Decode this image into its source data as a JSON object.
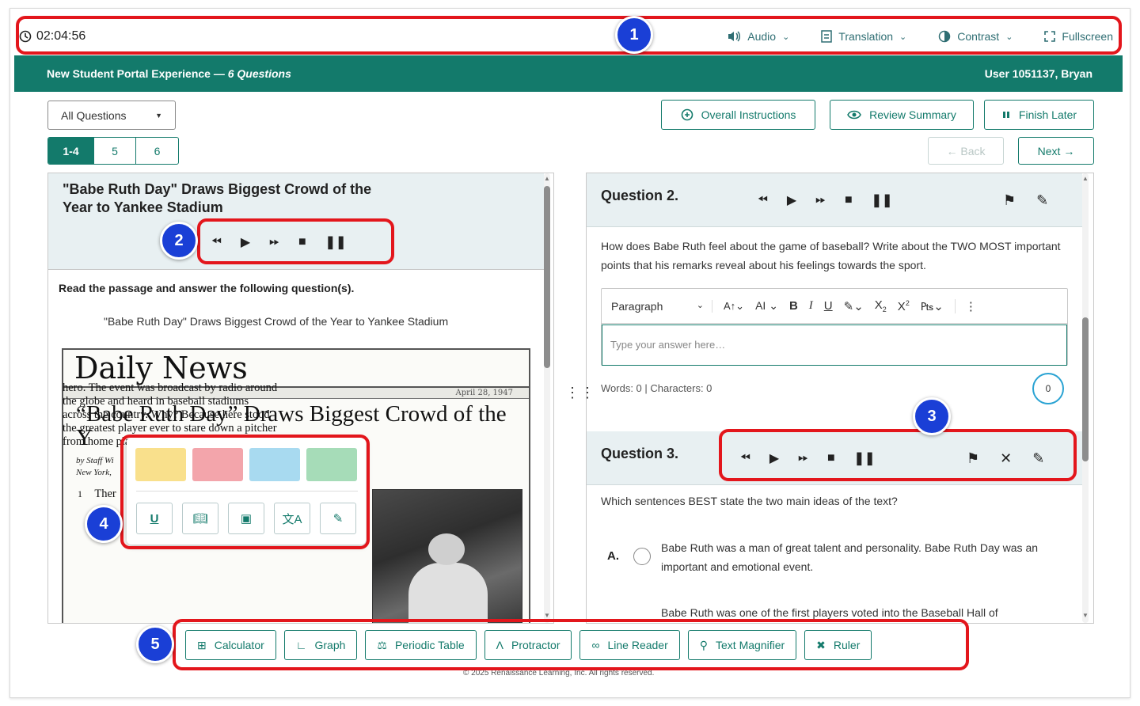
{
  "timer": "02:04:56",
  "top_tools": [
    {
      "icon": "speaker-icon",
      "label": "Audio"
    },
    {
      "icon": "translation-icon",
      "label": "Translation"
    },
    {
      "icon": "contrast-icon",
      "label": "Contrast"
    },
    {
      "icon": "fullscreen-icon",
      "label": "Fullscreen"
    }
  ],
  "header": {
    "title": "New Student Portal Experience —",
    "count": "6 Questions",
    "user": "User 1051137, Bryan"
  },
  "filter": {
    "selected": "All Questions"
  },
  "question_tabs": [
    "1-4",
    "5",
    "6"
  ],
  "actions": {
    "overall": "Overall Instructions",
    "review": "Review Summary",
    "finish": "Finish Later",
    "back": "← Back",
    "next": "Next →"
  },
  "passage": {
    "title": "\"Babe Ruth Day\" Draws Biggest Crowd of the Year to Yankee Stadium",
    "instruction": "Read the passage and answer the following question(s).",
    "subtitle": "\"Babe Ruth Day\" Draws Biggest Crowd of the Year to Yankee Stadium",
    "newspaper": "Daily News",
    "date": "April 28, 1947",
    "headline": "“Babe Ruth Day” Draws Biggest Crowd of the Y",
    "byline": [
      "by Staff Wi",
      "New York, "
    ],
    "para_number": "1",
    "article_start": "Ther",
    "article_lines": [
      "hero. The event was broadcast by radio around",
      "the globe and heard in baseball stadiums",
      "across the country. Why? Because here stood",
      "the greatest player ever to stare down a pitcher",
      "from home plate."
    ]
  },
  "palette": {
    "colors": [
      "#f9e08c",
      "#f3a5ab",
      "#a8daf0",
      "#a6dcb8"
    ],
    "tools": [
      "underline-icon",
      "dictionary-icon",
      "picture-dictionary-icon",
      "translate-icon",
      "notes-icon"
    ]
  },
  "questions": [
    {
      "title": "Question 2.",
      "prompt": "How does Babe Ruth feel about the game of baseball? Write about the TWO MOST important points that his remarks reveal about his feelings towards the sport.",
      "editor_style": "Paragraph",
      "placeholder": "Type your answer here…",
      "counts": "Words: 0 | Characters: 0",
      "char_count": "0"
    },
    {
      "title": "Question 3.",
      "prompt": "Which sentences BEST state the two main ideas of the text?",
      "options": [
        {
          "letter": "A.",
          "text": "Babe Ruth was a man of great talent and personality. Babe Ruth Day was an important and emotional event."
        },
        {
          "letter": "",
          "text": "Babe Ruth was one of the first players voted into the Baseball Hall of"
        }
      ]
    }
  ],
  "bottom_tools": [
    {
      "icon": "calculator-icon",
      "label": "Calculator"
    },
    {
      "icon": "graph-icon",
      "label": "Graph"
    },
    {
      "icon": "flask-icon",
      "label": "Periodic Table"
    },
    {
      "icon": "protractor-icon",
      "label": "Protractor"
    },
    {
      "icon": "glasses-icon",
      "label": "Line Reader"
    },
    {
      "icon": "magnifier-icon",
      "label": "Text Magnifier"
    },
    {
      "icon": "ruler-icon",
      "label": "Ruler"
    }
  ],
  "copyright": "© 2025 Renaissance Learning, Inc. All rights reserved.",
  "annotations": [
    "1",
    "2",
    "3",
    "4",
    "5"
  ],
  "colors": {
    "accent": "#137a6b",
    "annotation_red": "#e3161c",
    "annotation_blue": "#1a3fd6"
  }
}
